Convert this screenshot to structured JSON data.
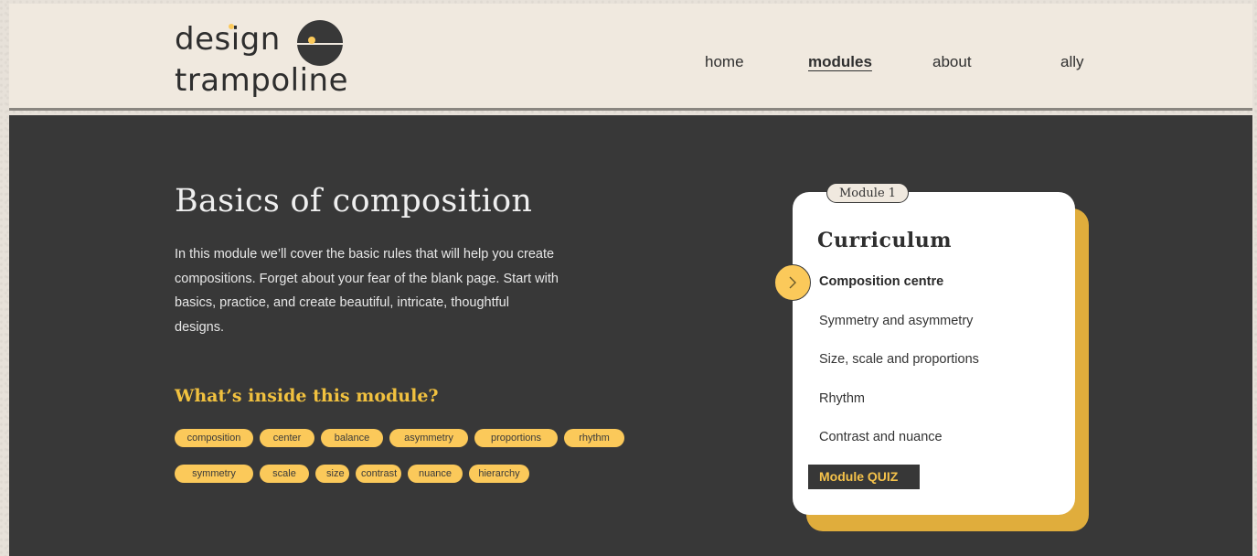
{
  "brand": {
    "line1": "design",
    "line2": "trampoline"
  },
  "nav": {
    "items": [
      {
        "label": "home",
        "active": false
      },
      {
        "label": "modules",
        "active": true
      },
      {
        "label": "about",
        "active": false
      },
      {
        "label": "ally",
        "active": false
      }
    ]
  },
  "hero": {
    "title": "Basics of composition",
    "description": "In this module we’ll cover the basic rules that will help you create compositions. Forget about your fear of the blank page. Start with basics, practice, and create beautiful, intricate, thoughtful designs."
  },
  "inside": {
    "title": "What’s inside this module?",
    "tags_row1": [
      "composition",
      "center",
      "balance",
      "asymmetry",
      "proportions",
      "rhythm"
    ],
    "tags_row2": [
      "symmetry",
      "scale",
      "size",
      "contrast",
      "nuance",
      "hierarchy"
    ]
  },
  "curriculum": {
    "badge": "Module 1",
    "title": "Curriculum",
    "lessons": [
      "Composition centre",
      "Symmetry and asymmetry",
      "Size, scale and proportions",
      "Rhythm",
      "Contrast and nuance"
    ],
    "current_index": 0,
    "quiz_label": "Module QUIZ"
  },
  "colors": {
    "accent": "#fbc95a",
    "accent_dark": "#e0ad3c",
    "background_dark": "#383838",
    "header_bg": "#f0e9df"
  },
  "icons": {
    "indicator": "chevron-right-icon",
    "logo": "logo-mark-icon"
  }
}
